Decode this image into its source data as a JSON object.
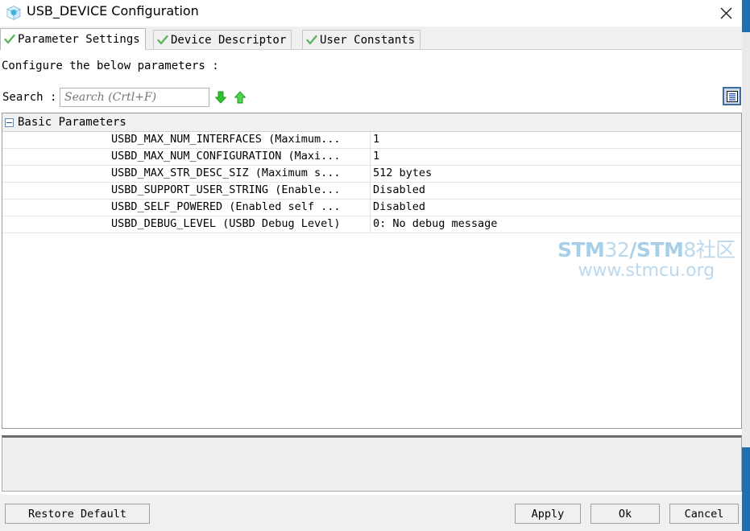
{
  "window": {
    "title": "USB_DEVICE Configuration",
    "icon": "cube-icon",
    "close_label": "✕"
  },
  "tabs": [
    {
      "label": "Parameter Settings",
      "icon": "green-check-icon",
      "active": true
    },
    {
      "label": "Device Descriptor",
      "icon": "green-check-icon",
      "active": false
    },
    {
      "label": "User Constants",
      "icon": "green-check-icon",
      "active": false
    }
  ],
  "body": {
    "configure_label": "Configure the below parameters :",
    "search_label": "Search :",
    "search_value": "",
    "search_placeholder": "Search (Crtl+F)",
    "find_next_icon": "arrow-down-icon",
    "find_prev_icon": "arrow-up-icon",
    "view_toggle_icon": "list-view-icon"
  },
  "table": {
    "group": {
      "label": "Basic Parameters",
      "expanded": true,
      "toggle_icon": "collapse-minus-icon"
    },
    "rows": [
      {
        "name": "USBD_MAX_NUM_INTERFACES (Maximum...",
        "value": "1"
      },
      {
        "name": "USBD_MAX_NUM_CONFIGURATION (Maxi...",
        "value": "1"
      },
      {
        "name": "USBD_MAX_STR_DESC_SIZ (Maximum s...",
        "value": "512 bytes"
      },
      {
        "name": "USBD_SUPPORT_USER_STRING (Enable...",
        "value": "Disabled"
      },
      {
        "name": "USBD_SELF_POWERED (Enabled self ...",
        "value": "Disabled"
      },
      {
        "name": "USBD_DEBUG_LEVEL (USBD Debug Level)",
        "value": "0: No debug message"
      }
    ]
  },
  "description_panel": {
    "text": ""
  },
  "watermark": {
    "line1_bold1": "STM",
    "line1_light1": "32",
    "line1_bold2": "/STM",
    "line1_light2": "8社区",
    "line2": "www.stmcu.org"
  },
  "footer": {
    "restore_label": "Restore Default",
    "apply_label": "Apply",
    "ok_label": "Ok",
    "cancel_label": "Cancel"
  },
  "colors": {
    "accent_blue": "#1f6fb2",
    "check_green": "#5ab45a",
    "arrow_green": "#2fc22f",
    "watermark_blue": "#a8cfe8",
    "toggle_border": "#3a6ea5"
  }
}
